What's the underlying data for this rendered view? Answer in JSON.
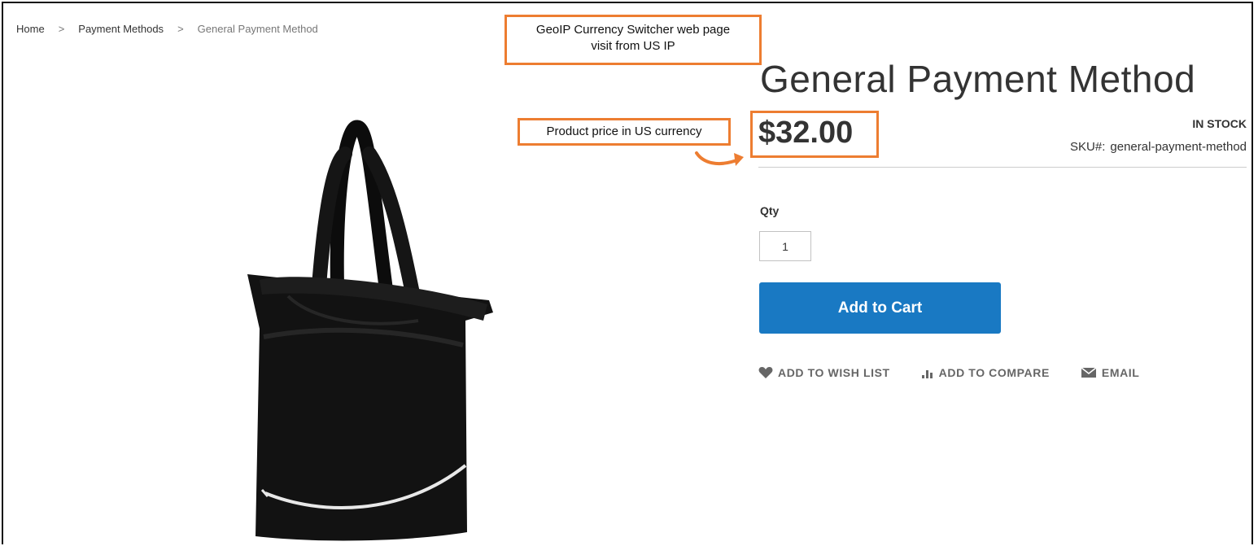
{
  "breadcrumb": {
    "items": [
      "Home",
      "Payment Methods",
      "General Payment Method"
    ],
    "separator": ">"
  },
  "annotations": {
    "geoip_note": "GeoIP Currency Switcher web page visit from US IP",
    "geoip_line1": "GeoIP Currency Switcher web page",
    "geoip_line2": "visit from US IP",
    "price_note": "Product price in US currency",
    "callout_color": "#ed7d31"
  },
  "product": {
    "title": "General Payment Method",
    "price": "$32.00",
    "stock_status": "IN STOCK",
    "sku_label": "SKU#:",
    "sku_value": "general-payment-method",
    "image_icon": "black-tote-bag-image"
  },
  "form": {
    "qty_label": "Qty",
    "qty_value": "1",
    "add_to_cart_label": "Add to Cart",
    "button_color": "#1979c3"
  },
  "actions": [
    {
      "label": "ADD TO WISH LIST",
      "icon": "heart-icon"
    },
    {
      "label": "ADD TO COMPARE",
      "icon": "bar-chart-icon"
    },
    {
      "label": "EMAIL",
      "icon": "envelope-icon"
    }
  ]
}
